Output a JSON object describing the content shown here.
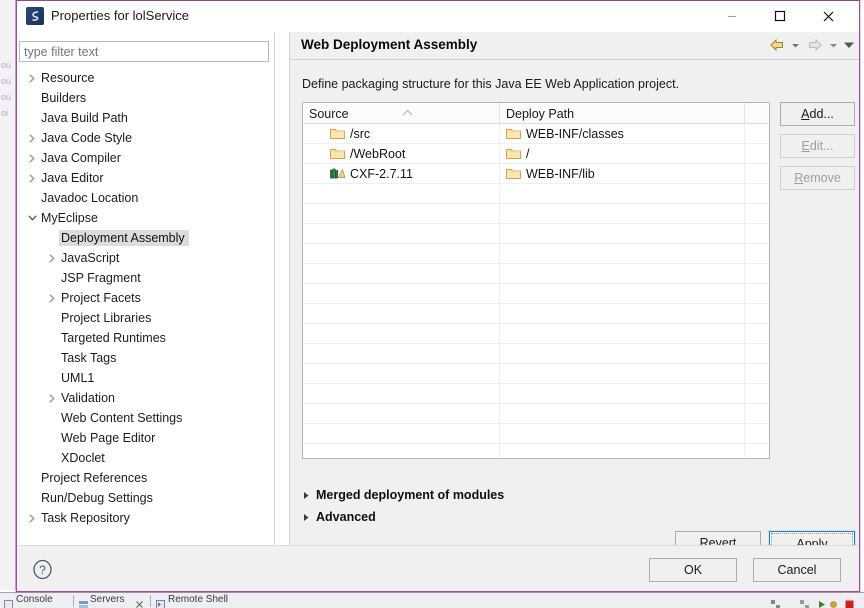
{
  "window": {
    "title": "Properties for lolService",
    "icon": "eclipse-properties-icon",
    "minimize_label": "–",
    "maximize_label": "□",
    "close_label": "✕",
    "border_color": "#9a4f9a"
  },
  "sidebar": {
    "filter": {
      "value": "",
      "placeholder": "type filter text"
    },
    "items": [
      {
        "label": "Resource",
        "indent": 0,
        "twisty": "collapsed",
        "selected": false
      },
      {
        "label": "Builders",
        "indent": 0,
        "twisty": "none",
        "selected": false
      },
      {
        "label": "Java Build Path",
        "indent": 0,
        "twisty": "none",
        "selected": false
      },
      {
        "label": "Java Code Style",
        "indent": 0,
        "twisty": "collapsed",
        "selected": false
      },
      {
        "label": "Java Compiler",
        "indent": 0,
        "twisty": "collapsed",
        "selected": false
      },
      {
        "label": "Java Editor",
        "indent": 0,
        "twisty": "collapsed",
        "selected": false
      },
      {
        "label": "Javadoc Location",
        "indent": 0,
        "twisty": "none",
        "selected": false
      },
      {
        "label": "MyEclipse",
        "indent": 0,
        "twisty": "expanded",
        "selected": false
      },
      {
        "label": "Deployment Assembly",
        "indent": 1,
        "twisty": "none",
        "selected": true
      },
      {
        "label": "JavaScript",
        "indent": 1,
        "twisty": "collapsed",
        "selected": false
      },
      {
        "label": "JSP Fragment",
        "indent": 1,
        "twisty": "none",
        "selected": false
      },
      {
        "label": "Project Facets",
        "indent": 1,
        "twisty": "collapsed",
        "selected": false
      },
      {
        "label": "Project Libraries",
        "indent": 1,
        "twisty": "none",
        "selected": false
      },
      {
        "label": "Targeted Runtimes",
        "indent": 1,
        "twisty": "none",
        "selected": false
      },
      {
        "label": "Task Tags",
        "indent": 1,
        "twisty": "none",
        "selected": false
      },
      {
        "label": "UML1",
        "indent": 1,
        "twisty": "none",
        "selected": false
      },
      {
        "label": "Validation",
        "indent": 1,
        "twisty": "collapsed",
        "selected": false
      },
      {
        "label": "Web Content Settings",
        "indent": 1,
        "twisty": "none",
        "selected": false
      },
      {
        "label": "Web Page Editor",
        "indent": 1,
        "twisty": "none",
        "selected": false
      },
      {
        "label": "XDoclet",
        "indent": 1,
        "twisty": "none",
        "selected": false
      },
      {
        "label": "Project References",
        "indent": 0,
        "twisty": "none",
        "selected": false
      },
      {
        "label": "Run/Debug Settings",
        "indent": 0,
        "twisty": "none",
        "selected": false
      },
      {
        "label": "Task Repository",
        "indent": 0,
        "twisty": "collapsed",
        "selected": false
      }
    ]
  },
  "page": {
    "title": "Web Deployment Assembly",
    "description": "Define packaging structure for this Java EE Web Application project.",
    "nav": {
      "back_icon": "back-arrow-icon",
      "back_menu_icon": "chevron-down-icon",
      "forward_icon": "forward-arrow-icon",
      "forward_menu_icon": "chevron-down-icon",
      "view_menu_icon": "chevron-down-icon"
    }
  },
  "table": {
    "columns": [
      {
        "label": "Source",
        "sort": "asc"
      },
      {
        "label": "Deploy Path",
        "sort": "none"
      },
      {
        "label": "",
        "sort": "none"
      }
    ],
    "rows": [
      {
        "source_icon": "folder-icon",
        "source": "/src",
        "deploy_icon": "folder-icon",
        "deploy": "WEB-INF/classes"
      },
      {
        "source_icon": "folder-icon",
        "source": "/WebRoot",
        "deploy_icon": "folder-icon",
        "deploy": "/"
      },
      {
        "source_icon": "library-icon",
        "source": "CXF-2.7.11",
        "deploy_icon": "folder-icon",
        "deploy": "WEB-INF/lib"
      }
    ],
    "empty_row_count": 16
  },
  "side_buttons": [
    {
      "label": "Add...",
      "mnemonic": "A",
      "enabled": true
    },
    {
      "label": "Edit...",
      "mnemonic": "E",
      "enabled": false
    },
    {
      "label": "Remove",
      "mnemonic": "R",
      "enabled": false
    }
  ],
  "expanders": [
    {
      "label": "Merged deployment of modules",
      "state": "collapsed"
    },
    {
      "label": "Advanced",
      "state": "collapsed"
    }
  ],
  "page_buttons": {
    "revert": {
      "label": "Revert",
      "mnemonic": "v",
      "focused": false
    },
    "apply": {
      "label": "Apply",
      "mnemonic": "A",
      "focused": true
    }
  },
  "footer": {
    "help_icon": "help-question-icon",
    "ok": "OK",
    "cancel": "Cancel"
  },
  "backdrop": {
    "ghost_lines": [
      "ou",
      "ou",
      "ou",
      "oi"
    ],
    "status_tabs": [
      "Console",
      "Servers",
      "Remote Shell"
    ]
  }
}
